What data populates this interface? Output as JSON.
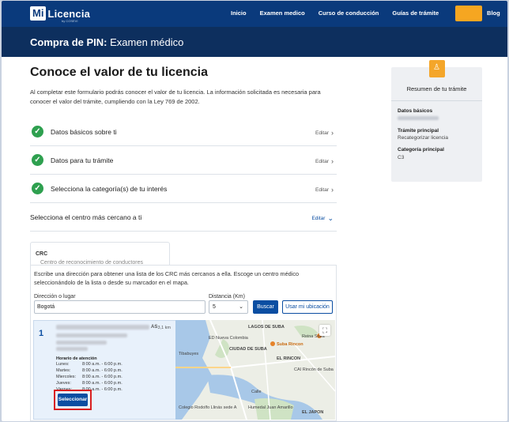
{
  "nav": {
    "logo_mi": "Mi",
    "logo_word": "Licencia",
    "logo_sub": "by COSEVI",
    "links": [
      "Inicio",
      "Examen medico",
      "Curso de conducción",
      "Guías de trámite",
      "Blog"
    ],
    "accent": "#f6a621"
  },
  "band": {
    "prefix": "Compra de PIN:",
    "title": "Examen médico"
  },
  "main": {
    "title": "Conoce el valor de tu licencia",
    "intro": "Al completar este formulario podrás conocer el valor de tu licencia. La información solicitada es necesaria para conocer el valor del trámite, cumpliendo con la Ley 769 de 2002.",
    "steps": [
      {
        "label": "Datos básicos sobre ti",
        "edit": "Editar"
      },
      {
        "label": "Datos para tu trámite",
        "edit": "Editar"
      },
      {
        "label": "Selecciona la categoría(s) de tu interés",
        "edit": "Editar"
      },
      {
        "label": "Selecciona el centro más cercano a ti",
        "edit": "Editar"
      }
    ],
    "tab": {
      "abbr": "CRC",
      "label": "Centro de reconocimiento de conductores"
    },
    "search": {
      "desc": "Escribe una dirección para obtener una lista de los CRC más cercanos a ella. Escoge un centro médico seleccionándolo de la lista o desde su marcador en el mapa.",
      "address_label": "Dirección o lugar",
      "address_value": "Bogotá",
      "distance_label": "Distancia (Km)",
      "distance_value": "5",
      "search_button": "Buscar",
      "location_button": "Usar mi ubicación"
    },
    "result": {
      "index": "1",
      "name_suffix": "AS",
      "distance": "3,1 km",
      "hours_title": "Horario de atención",
      "hours": [
        {
          "day": "Lunes:",
          "time": "8:00 a.m. - 6:00 p.m."
        },
        {
          "day": "Martes:",
          "time": "8:00 a.m. - 6:00 p.m."
        },
        {
          "day": "Miercoles:",
          "time": "8:00 a.m. - 6:00 p.m."
        },
        {
          "day": "Jueves:",
          "time": "8:00 a.m. - 6:00 p.m."
        },
        {
          "day": "Viernes:",
          "time": "8:00 a.m. - 6:00 p.m."
        }
      ],
      "select_button": "Seleccionar"
    },
    "map_labels": [
      "LAGOS DE SUBA",
      "Reina Sofía",
      "ED Nueva Colombia",
      "Suba Rincon",
      "CIUDAD DE SUBA",
      "EL RINCON",
      "CAI Rincón de Suba",
      "Colegio Rodolfo Llinás sede A",
      "Humedal Juan Amarillo",
      "EL JAPON",
      "Tibabuyes",
      "Calle"
    ]
  },
  "summary": {
    "title": "Resumen de tu trámite",
    "items": [
      {
        "key": "Datos básicos",
        "value": ""
      },
      {
        "key": "Trámite principal",
        "value": "Recategorizar licencia"
      },
      {
        "key": "Categoría principal",
        "value": "C3"
      }
    ]
  }
}
